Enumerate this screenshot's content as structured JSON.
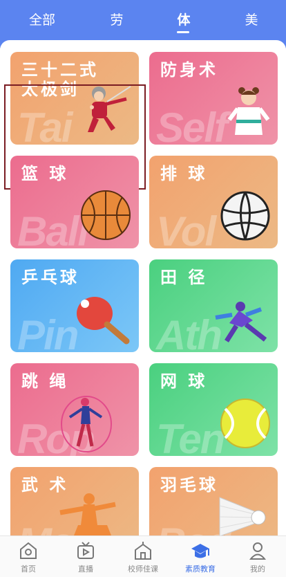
{
  "tabs": [
    {
      "label": "全部"
    },
    {
      "label": "劳"
    },
    {
      "label": "体",
      "active": true
    },
    {
      "label": "美"
    }
  ],
  "cards": [
    {
      "title": "三十二式\n太极剑",
      "watermark": "Tai",
      "theme": "orange",
      "icon": "tai-chi-sword-grandma-icon",
      "selected": true
    },
    {
      "title": "防身术",
      "watermark": "Self",
      "theme": "pink",
      "icon": "karate-girl-icon"
    },
    {
      "title": "篮 球",
      "watermark": "Ball",
      "theme": "pink",
      "icon": "basketball-icon"
    },
    {
      "title": "排 球",
      "watermark": "Vol",
      "theme": "orange",
      "icon": "volleyball-icon"
    },
    {
      "title": "乒乓球",
      "watermark": "Pin",
      "theme": "blue",
      "icon": "ping-pong-paddle-icon"
    },
    {
      "title": "田 径",
      "watermark": "Ath",
      "theme": "green",
      "icon": "sprinter-icon"
    },
    {
      "title": "跳 绳",
      "watermark": "Rop",
      "theme": "pink",
      "icon": "jump-rope-icon"
    },
    {
      "title": "网 球",
      "watermark": "Ten",
      "theme": "green",
      "icon": "tennis-ball-icon"
    },
    {
      "title": "武 术",
      "watermark": "Mar",
      "theme": "orange",
      "icon": "martial-arts-icon"
    },
    {
      "title": "羽毛球",
      "watermark": "Bad",
      "theme": "orange",
      "icon": "shuttlecock-icon"
    }
  ],
  "bottom_nav": [
    {
      "label": "首页",
      "icon": "home-icon"
    },
    {
      "label": "直播",
      "icon": "live-tv-icon"
    },
    {
      "label": "校师佳课",
      "icon": "school-icon"
    },
    {
      "label": "素质教育",
      "icon": "graduation-cap-icon",
      "active": true
    },
    {
      "label": "我的",
      "icon": "profile-icon"
    }
  ],
  "colors": {
    "header": "#5b84f0",
    "active_nav": "#3c6fe6",
    "selection_outline": "#7a1c22"
  }
}
